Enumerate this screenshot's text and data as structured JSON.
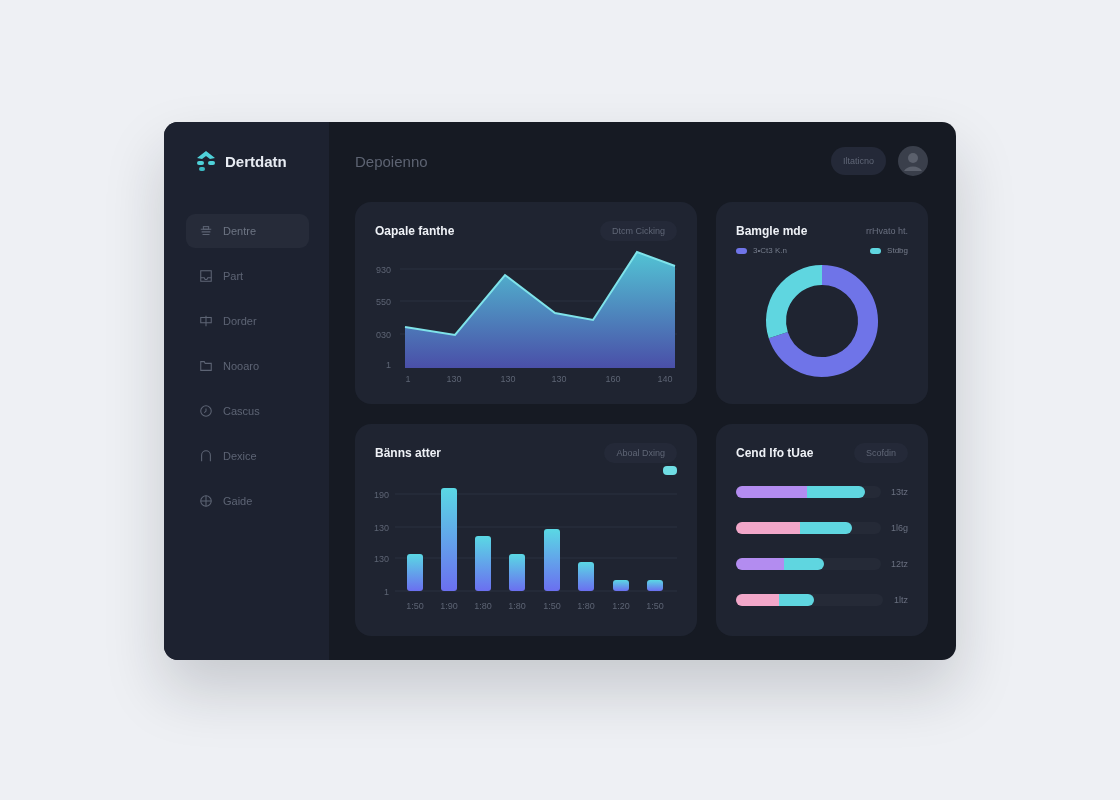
{
  "brand": {
    "name": "Dertdatn"
  },
  "sidebar": {
    "items": [
      {
        "label": "Dentre",
        "selected": true
      },
      {
        "label": "Part",
        "selected": false
      },
      {
        "label": "Dorder",
        "selected": false
      },
      {
        "label": "Nooaro",
        "selected": false
      },
      {
        "label": "Cascus",
        "selected": false
      },
      {
        "label": "Dexice",
        "selected": false
      },
      {
        "label": "Gaide",
        "selected": false
      }
    ]
  },
  "header": {
    "title": "Depoienno",
    "button": "Iltaticno"
  },
  "line_card": {
    "title": "Oapale fanthe",
    "button": "Dtcm Cicking",
    "yticks": [
      "930",
      "550",
      "030",
      "1"
    ],
    "xticks": [
      "1",
      "130",
      "130",
      "130",
      "160",
      "140"
    ]
  },
  "donut_card": {
    "title": "Bamgle mde",
    "note": "rrHvato ht.",
    "legend": [
      {
        "label": "3•Ct3 K.n",
        "color": "#6f74e8"
      },
      {
        "label": "Stdbg",
        "color": "#5fd6e0"
      }
    ]
  },
  "bar_card": {
    "title": "Bänns atter",
    "button": "Aboal Dxing",
    "yticks": [
      "190",
      "130",
      "130",
      "1"
    ],
    "xticks": [
      "1:50",
      "1:90",
      "1:80",
      "1:80",
      "1:50",
      "1:80",
      "1:20",
      "1:50"
    ]
  },
  "progress_card": {
    "title": "Cend lfo tUae",
    "button": "Scofdin",
    "rows": [
      {
        "level": 0.89,
        "color": "#b38cf0",
        "reading": "13tz"
      },
      {
        "level": 0.8,
        "color": "#f2a7c9",
        "reading": "1l6g"
      },
      {
        "level": 0.61,
        "color": "#b38cf0",
        "reading": "12tz"
      },
      {
        "level": 0.53,
        "color": "#f2a7c9",
        "reading": "1ltz"
      }
    ]
  }
}
